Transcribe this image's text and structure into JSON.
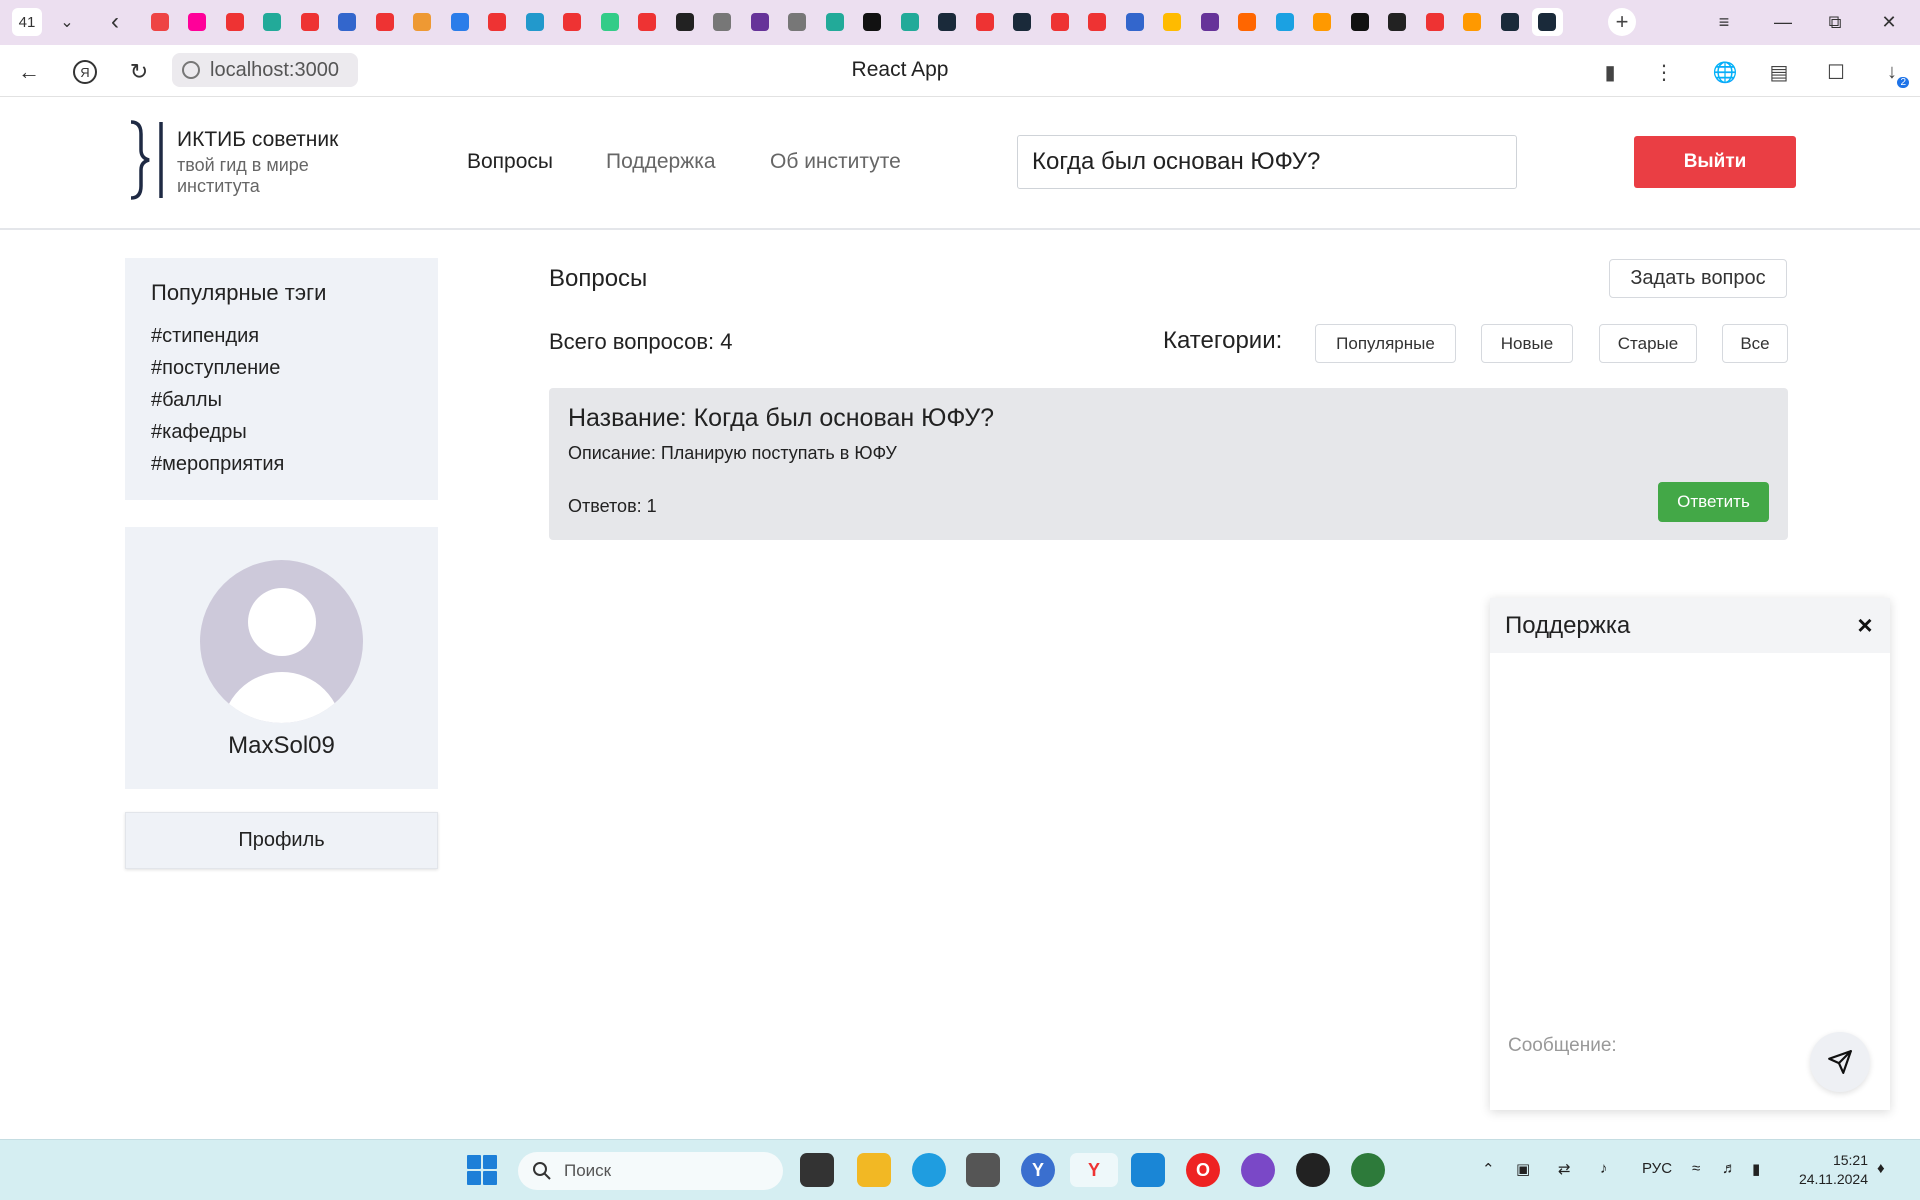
{
  "browser": {
    "tab_count": "41",
    "page_title": "React App",
    "url": "localhost:3000",
    "download_badge": "2",
    "tab_colors": [
      "#e44",
      "#f09",
      "#e33",
      "#2a9",
      "#e33",
      "#36c",
      "#e33",
      "#e93",
      "#2b7de9",
      "#e33",
      "#29c",
      "#e33",
      "#3c8",
      "#e33",
      "#222",
      "#777",
      "#639",
      "#777",
      "#2a9",
      "#111",
      "#2a9",
      "#1a2a3a",
      "#e33",
      "#1a2a3a",
      "#e33",
      "#e33",
      "#36c",
      "#fb0",
      "#639",
      "#f60",
      "#1ba1e2",
      "#f90",
      "#111",
      "#222",
      "#e33",
      "#f90",
      "#1a2a3a",
      "#1a2a3a"
    ]
  },
  "app": {
    "logo": {
      "title": "ИКТИБ советник",
      "subtitle": "твой гид в мире института"
    },
    "nav": {
      "questions": "Вопросы",
      "support": "Поддержка",
      "about": "Об институте"
    },
    "search": {
      "value": "Когда был основан ЮФУ?"
    },
    "logout_label": "Выйти"
  },
  "sidebar": {
    "tags_title": "Популярные тэги",
    "tags": [
      "#стипендия",
      "#поступление",
      "#баллы",
      "#кафедры",
      "#мероприятия"
    ],
    "username": "MaxSol09",
    "profile_button": "Профиль"
  },
  "main": {
    "title": "Вопросы",
    "ask_button": "Задать вопрос",
    "total_label": "Всего вопросов: 4",
    "categories_label": "Категории:",
    "categories": [
      "Популярные",
      "Новые",
      "Старые",
      "Все"
    ],
    "questions": [
      {
        "title": "Название: Когда был основан ЮФУ?",
        "description": "Описание: Планирую поступать в ЮФУ",
        "answers": "Ответов: 1",
        "answer_button": "Ответить"
      }
    ]
  },
  "chat": {
    "title": "Поддержка",
    "close_icon": "×",
    "input_placeholder": "Сообщение:"
  },
  "taskbar": {
    "search_placeholder": "Поиск",
    "language": "РУС",
    "time": "15:21",
    "date": "24.11.2024"
  },
  "colors": {
    "accent_red": "#ea3e44",
    "answer_green": "#43a847",
    "card_bg": "#eff2f7"
  }
}
